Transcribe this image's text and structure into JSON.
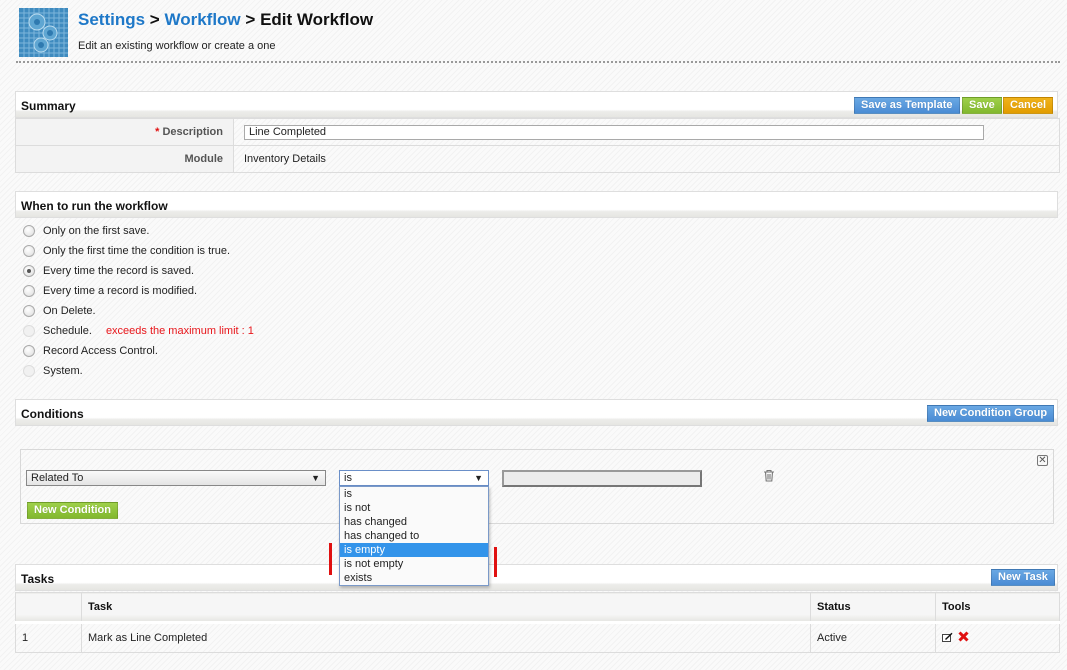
{
  "header": {
    "breadcrumb": [
      "Settings",
      "Workflow",
      "Edit Workflow"
    ],
    "separator": ">",
    "subtitle": "Edit an existing workflow or create a one",
    "logo_icon": "workflow-gears-icon"
  },
  "summary": {
    "title": "Summary",
    "buttons": {
      "save_as_template": "Save as Template",
      "save": "Save",
      "cancel": "Cancel"
    },
    "required_mark": "*",
    "description_label": "Description",
    "description_value": "Line Completed",
    "module_label": "Module",
    "module_value": "Inventory Details"
  },
  "when_to_run": {
    "title": "When to run the workflow",
    "options": [
      {
        "label": "Only on the first save.",
        "checked": false,
        "disabled": false
      },
      {
        "label": "Only the first time the condition is true.",
        "checked": false,
        "disabled": false
      },
      {
        "label": "Every time the record is saved.",
        "checked": true,
        "disabled": false
      },
      {
        "label": "Every time a record is modified.",
        "checked": false,
        "disabled": false
      },
      {
        "label": "On Delete.",
        "checked": false,
        "disabled": false
      },
      {
        "label": "Schedule.",
        "checked": false,
        "disabled": true,
        "warning": "exceeds the maximum limit : 1"
      },
      {
        "label": "Record Access Control.",
        "checked": false,
        "disabled": false
      },
      {
        "label": "System.",
        "checked": false,
        "disabled": true
      }
    ]
  },
  "conditions": {
    "title": "Conditions",
    "new_group_button": "New Condition Group",
    "field_select": "Related To",
    "operator_select": "is",
    "value": "",
    "new_condition_button": "New Condition",
    "operator_options": [
      "is",
      "is not",
      "has changed",
      "has changed to",
      "is empty",
      "is not empty",
      "exists"
    ],
    "highlighted_option": "is empty"
  },
  "tasks": {
    "title": "Tasks",
    "new_task_button": "New Task",
    "columns": [
      "",
      "Task",
      "Status",
      "Tools"
    ],
    "rows": [
      {
        "index": "1",
        "task": "Mark as Line Completed",
        "status": "Active"
      }
    ]
  },
  "colors": {
    "link": "#1e78c8",
    "warning": "#e8161b",
    "btn_blue": "#4a8cd4",
    "btn_green": "#82b82e",
    "btn_orange": "#e29c00",
    "highlight": "#3394ea"
  }
}
